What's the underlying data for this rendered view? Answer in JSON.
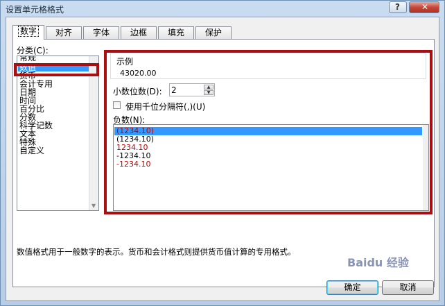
{
  "window": {
    "title": "设置单元格格式",
    "help_label": "?",
    "close_label": "✕"
  },
  "tabs": [
    {
      "label": "数字",
      "active": true
    },
    {
      "label": "对齐"
    },
    {
      "label": "字体"
    },
    {
      "label": "边框"
    },
    {
      "label": "填充"
    },
    {
      "label": "保护"
    }
  ],
  "category": {
    "label": "分类(C):",
    "items": [
      "常规",
      "数值",
      "货币",
      "会计专用",
      "日期",
      "时间",
      "百分比",
      "分数",
      "科学记数",
      "文本",
      "特殊",
      "自定义"
    ],
    "selected": "数值"
  },
  "sample": {
    "label": "示例",
    "value": "43020.00"
  },
  "decimals": {
    "label": "小数位数(D):",
    "value": "2"
  },
  "thousands": {
    "label": "使用千位分隔符(,)(U)",
    "checked": false
  },
  "negative": {
    "label": "负数(N):",
    "items": [
      {
        "text": "(1234.10)",
        "color": "#c00000",
        "selected": true
      },
      {
        "text": "(1234.10)",
        "color": "#000000"
      },
      {
        "text": "1234.10",
        "color": "#c00000"
      },
      {
        "text": "-1234.10",
        "color": "#000000"
      },
      {
        "text": "-1234.10",
        "color": "#c00000"
      }
    ]
  },
  "description": "数值格式用于一般数字的表示。货币和会计格式则提供货币值计算的专用格式。",
  "buttons": {
    "ok": "确定",
    "cancel": "取消"
  },
  "watermark": "Baidu 经验",
  "colors": {
    "highlight": "#3399ff",
    "annotation": "#a90e13",
    "negative_red": "#c00000"
  }
}
